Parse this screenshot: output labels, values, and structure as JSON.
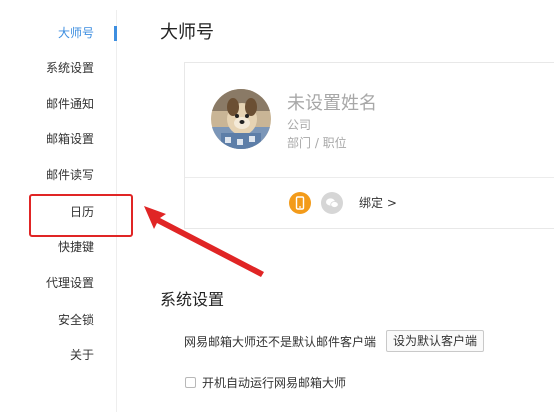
{
  "sidebar": {
    "items": [
      {
        "label": "大师号",
        "active": true
      },
      {
        "label": "系统设置"
      },
      {
        "label": "邮件通知"
      },
      {
        "label": "邮箱设置"
      },
      {
        "label": "邮件读写"
      },
      {
        "label": "日历"
      },
      {
        "label": "快捷键"
      },
      {
        "label": "代理设置"
      },
      {
        "label": "安全锁"
      },
      {
        "label": "关于"
      }
    ]
  },
  "main": {
    "title": "大师号",
    "profile": {
      "name": "未设置姓名",
      "company": "公司",
      "department": "部门 / 职位",
      "bind_label": "绑定 >"
    },
    "system_settings": {
      "title": "系统设置",
      "default_client_text": "网易邮箱大师还不是默认邮件客户端",
      "set_default_button": "设为默认客户端",
      "autorun_label": "开机自动运行网易邮箱大师",
      "autorun_checked": false
    }
  },
  "colors": {
    "accent": "#3d8ee0",
    "highlight": "#e02525",
    "phone_icon_bg": "#f39b1a",
    "wechat_icon_bg": "#d6d6d6"
  }
}
